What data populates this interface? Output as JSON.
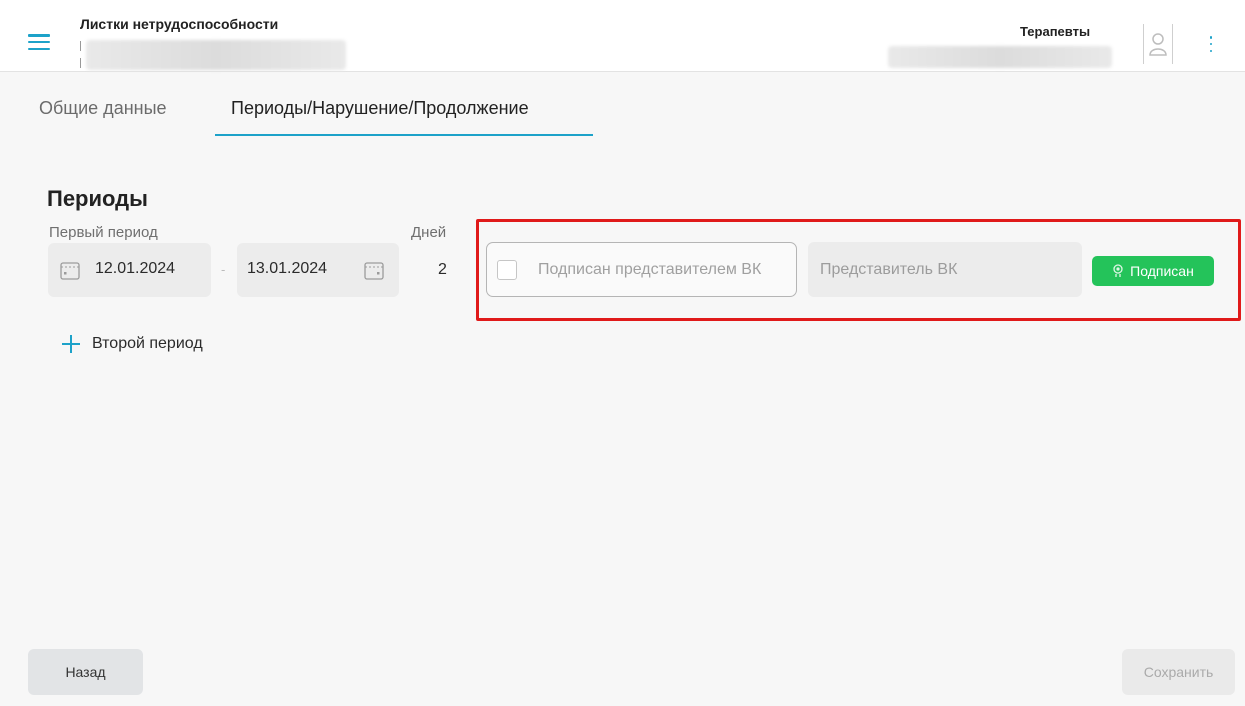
{
  "header": {
    "title": "Листки нетрудоспособности",
    "department": "Терапевты"
  },
  "tabs": [
    {
      "label": "Общие данные",
      "active": false
    },
    {
      "label": "Периоды/Нарушение/Продолжение",
      "active": true
    }
  ],
  "periods": {
    "title": "Периоды",
    "first_period_label": "Первый период",
    "days_label": "Дней",
    "date_from": "12.01.2024",
    "date_to": "13.01.2024",
    "days": "2",
    "vk_checkbox_label": "Подписан представителем ВК",
    "vk_checked": false,
    "vk_rep_placeholder": "Представитель ВК",
    "signed_button": "Подписан",
    "add_period": "Второй период"
  },
  "footer": {
    "back": "Назад",
    "save": "Сохранить"
  },
  "colors": {
    "accent": "#1da2c9",
    "success": "#24c35a",
    "highlight": "#e01a1a"
  },
  "icons": [
    "menu-icon",
    "user-icon",
    "more-vert-icon",
    "calendar-icon",
    "plus-icon",
    "signature-icon"
  ]
}
